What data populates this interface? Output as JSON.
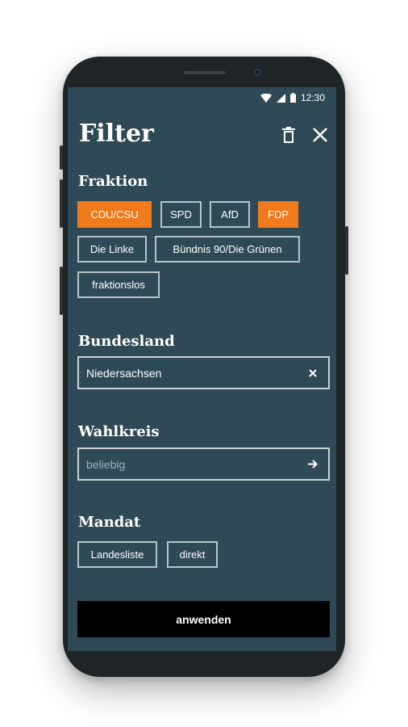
{
  "status_bar": {
    "time": "12:30"
  },
  "header": {
    "title": "Filter",
    "icons": [
      "trash-icon",
      "close-icon"
    ]
  },
  "fraktion": {
    "label": "Fraktion",
    "chips": [
      {
        "label": "CDU/CSU",
        "selected": true
      },
      {
        "label": "SPD",
        "selected": false
      },
      {
        "label": "AfD",
        "selected": false
      },
      {
        "label": "FDP",
        "selected": true
      },
      {
        "label": "Die Linke",
        "selected": false
      },
      {
        "label": "Bündnis 90/Die Grünen",
        "selected": false
      },
      {
        "label": "fraktionslos",
        "selected": false
      }
    ]
  },
  "bundesland": {
    "label": "Bundesland",
    "value": "Niedersachsen",
    "icon": "clear-icon"
  },
  "wahlkreis": {
    "label": "Wahlkreis",
    "placeholder": "beliebig",
    "icon": "arrow-right-icon"
  },
  "mandat": {
    "label": "Mandat",
    "chips": [
      {
        "label": "Landesliste",
        "selected": false
      },
      {
        "label": "direkt",
        "selected": false
      }
    ]
  },
  "apply_button": {
    "label": "anwenden"
  },
  "colors": {
    "background": "#2f4a57",
    "accent": "#f07a1c",
    "apply": "#000000"
  }
}
